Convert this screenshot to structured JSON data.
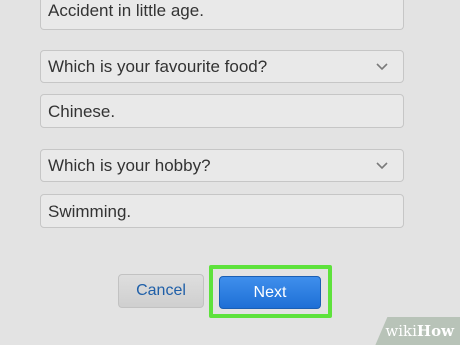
{
  "answer1": {
    "value": "Accident in little age."
  },
  "question2": {
    "selected": "Which is your favourite food?",
    "icon": "chevron-down-icon"
  },
  "answer2": {
    "value": "Chinese."
  },
  "question3": {
    "selected": "Which is your hobby?",
    "icon": "chevron-down-icon"
  },
  "answer3": {
    "value": "Swimming."
  },
  "buttons": {
    "cancel_label": "Cancel",
    "next_label": "Next"
  },
  "colors": {
    "background": "#e3e3e3",
    "next_button": "#2274dc",
    "highlight": "#5ee23c",
    "cancel_text": "#1f5fa8"
  },
  "watermark": {
    "wiki": "wiki",
    "how": "How"
  }
}
